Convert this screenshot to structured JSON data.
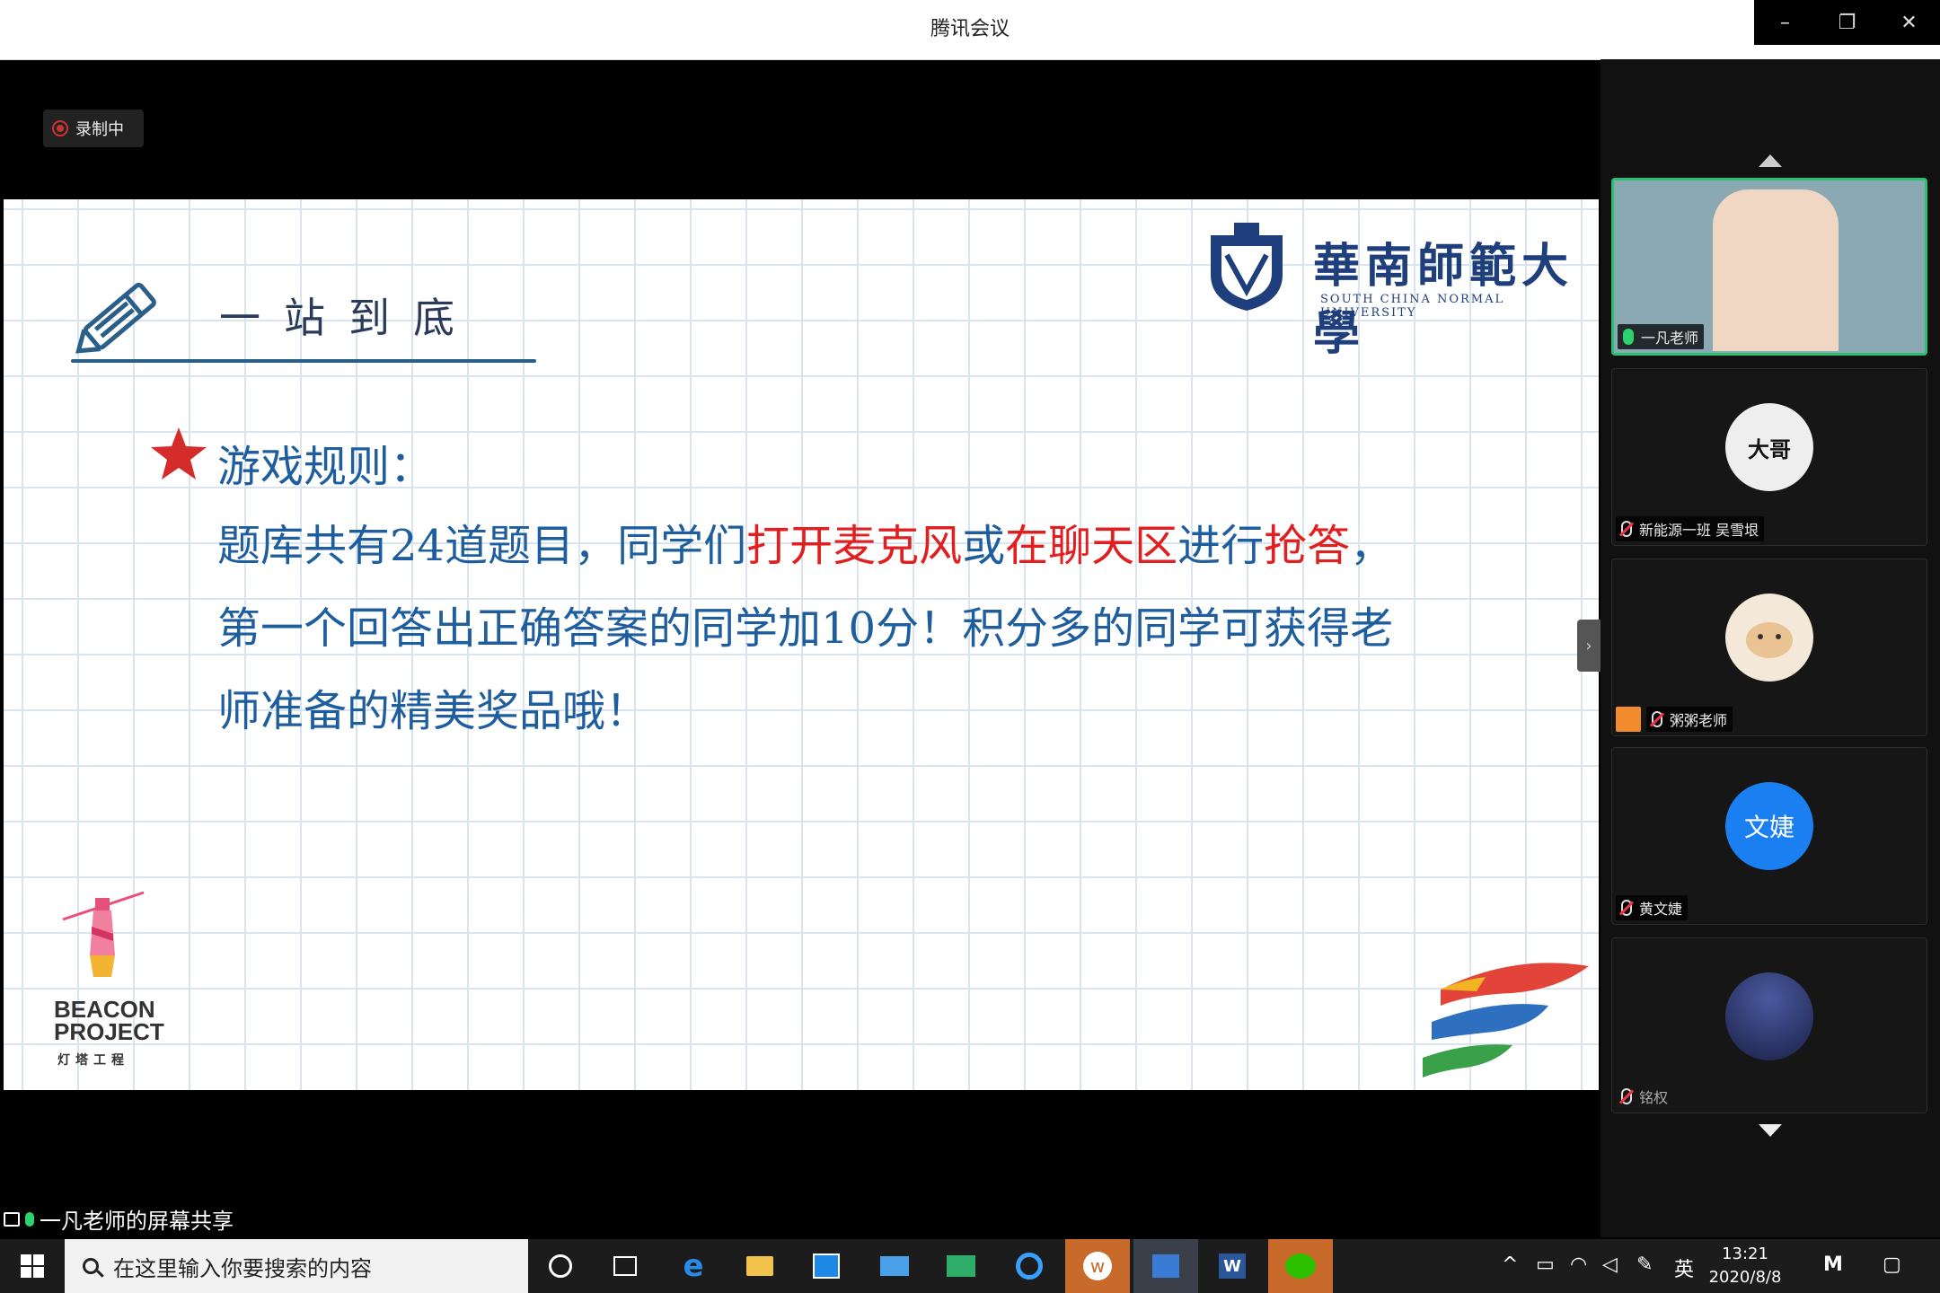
{
  "window": {
    "title": "腾讯会议",
    "controls": [
      "–",
      "❐",
      "✕"
    ]
  },
  "recording": {
    "label": "录制中"
  },
  "slide": {
    "heading": "一站到底",
    "university_cn": "華南師範大學",
    "university_en": "SOUTH CHINA NORMAL UNIVERSITY",
    "rules_title": "游戏规则：",
    "rules_body": [
      {
        "text": "题库共有24道题目，同学们",
        "highlight": false
      },
      {
        "text": "打开麦克风",
        "highlight": true
      },
      {
        "text": "或",
        "highlight": false
      },
      {
        "text": "在聊天区",
        "highlight": true
      },
      {
        "text": "进行",
        "highlight": false
      },
      {
        "text": "抢答",
        "highlight": true
      },
      {
        "text": "，第一个回答出正确答案的同学加10分！积分多的同学可获得老师准备的精美奖品哦！",
        "highlight": false
      }
    ],
    "beacon_line1": "BEACON",
    "beacon_line2": "PROJECT",
    "beacon_cn": "灯塔工程"
  },
  "participants": [
    {
      "name": "一凡老师",
      "mic": "on",
      "avatar_text": "",
      "avatar_color": "#9fb8c0"
    },
    {
      "name": "新能源一班 吴雪垠",
      "mic": "off",
      "avatar_text": "大哥",
      "avatar_color": "#eeeeee"
    },
    {
      "name": "粥粥老师",
      "mic": "off",
      "avatar_text": "",
      "avatar_color": "#f4e8d8"
    },
    {
      "name": "黄文婕",
      "mic": "off",
      "avatar_text": "文婕",
      "avatar_color": "#1a7ff0"
    },
    {
      "name": "铭权",
      "mic": "off",
      "avatar_text": "",
      "avatar_color": "#2a3a6a"
    }
  ],
  "share_caption": "一凡老师的屏幕共享",
  "taskbar": {
    "search_placeholder": "在这里输入你要搜索的内容",
    "time": "13:21",
    "date": "2020/8/8",
    "ime": "英"
  },
  "colors": {
    "accent": "#2bbf6f",
    "slide_text": "#1e5e9e",
    "highlight": "#e02020"
  }
}
